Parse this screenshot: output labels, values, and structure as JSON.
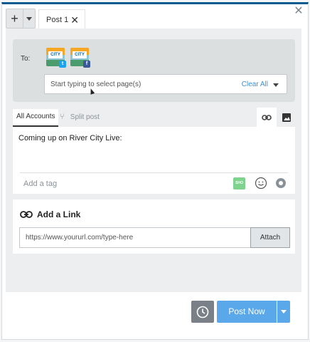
{
  "tabs": {
    "add_label": "+",
    "post_tab_label": "Post 1",
    "post_tab_close": "✕"
  },
  "dialog": {
    "close_glyph": "✕"
  },
  "recipients": {
    "to_label": "To:",
    "avatars": [
      {
        "network": "twitter",
        "badge": "t",
        "brand_color": "#1da1f2"
      },
      {
        "network": "facebook",
        "badge": "f",
        "brand_color": "#3b5998"
      }
    ],
    "select_placeholder": "Start typing to select page(s)",
    "clear_all_label": "Clear All"
  },
  "account_tabs": {
    "all_accounts": "All Accounts",
    "split_post": "Split post"
  },
  "composer": {
    "message": "Coming up on River City Live:",
    "tag_placeholder": "Add a tag",
    "icons": [
      "shutterstock-icon",
      "emoji-icon",
      "donut-icon"
    ]
  },
  "link_section": {
    "title": "Add a Link",
    "url_placeholder": "https://www.yoururl.com/type-here",
    "attach_label": "Attach"
  },
  "footer": {
    "post_now_label": "Post Now",
    "accent_color": "#5aa8ea"
  }
}
